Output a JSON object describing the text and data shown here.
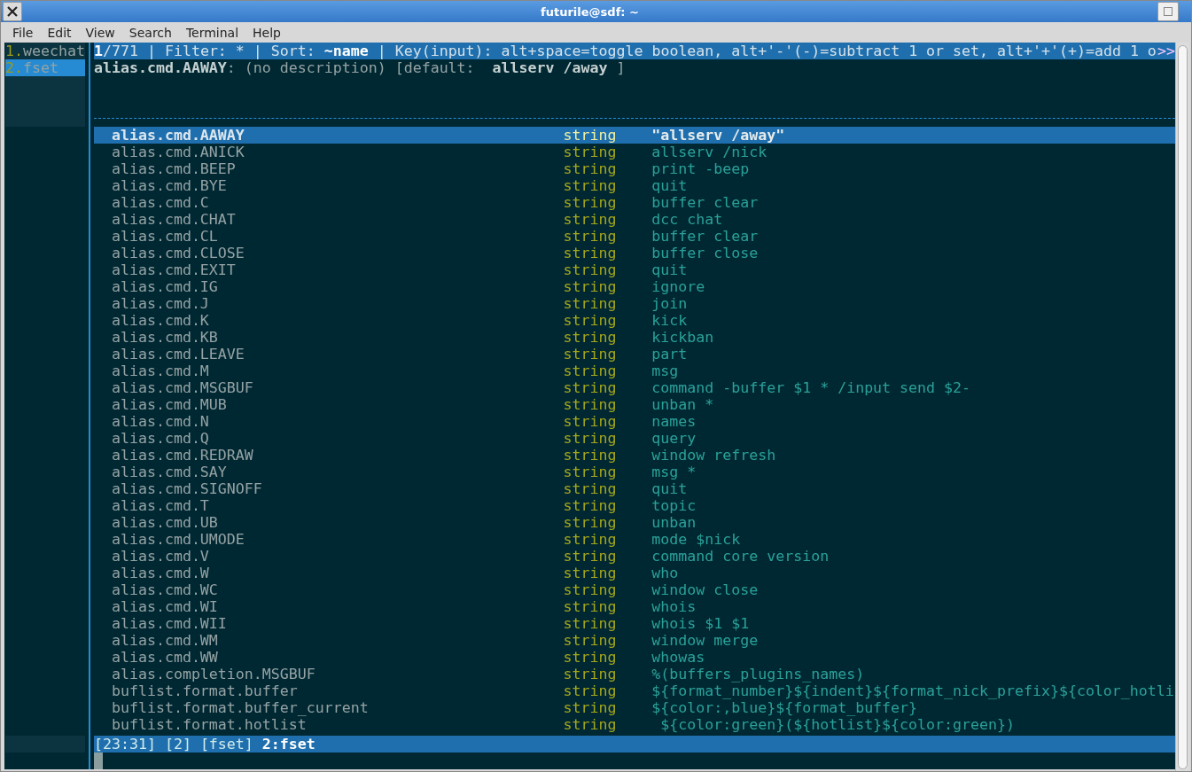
{
  "window": {
    "title": "futurile@sdf: ~"
  },
  "menu": [
    "File",
    "Edit",
    "View",
    "Search",
    "Terminal",
    "Help"
  ],
  "buflist": [
    {
      "number": "1.",
      "name": "weechat",
      "selected": false
    },
    {
      "number": "2.",
      "name": "fset",
      "selected": true
    }
  ],
  "fset": {
    "title": "**1**/771 | Filter: * | Sort: **~name** | Key(input): alt+space=toggle boolean, alt+'-'(-)=subtract 1 or set, alt+'+'(+)=add 1 o",
    "title_more": ">>",
    "description": "**alias.cmd.AAWAY**: (no description) [default:  **allserv /away** ]",
    "options": [
      {
        "name": "alias.cmd.AAWAY",
        "type": "string",
        "value": "\"allserv /away\"",
        "selected": true
      },
      {
        "name": "alias.cmd.ANICK",
        "type": "string",
        "value": "allserv /nick",
        "selected": false
      },
      {
        "name": "alias.cmd.BEEP",
        "type": "string",
        "value": "print -beep",
        "selected": false
      },
      {
        "name": "alias.cmd.BYE",
        "type": "string",
        "value": "quit",
        "selected": false
      },
      {
        "name": "alias.cmd.C",
        "type": "string",
        "value": "buffer clear",
        "selected": false
      },
      {
        "name": "alias.cmd.CHAT",
        "type": "string",
        "value": "dcc chat",
        "selected": false
      },
      {
        "name": "alias.cmd.CL",
        "type": "string",
        "value": "buffer clear",
        "selected": false
      },
      {
        "name": "alias.cmd.CLOSE",
        "type": "string",
        "value": "buffer close",
        "selected": false
      },
      {
        "name": "alias.cmd.EXIT",
        "type": "string",
        "value": "quit",
        "selected": false
      },
      {
        "name": "alias.cmd.IG",
        "type": "string",
        "value": "ignore",
        "selected": false
      },
      {
        "name": "alias.cmd.J",
        "type": "string",
        "value": "join",
        "selected": false
      },
      {
        "name": "alias.cmd.K",
        "type": "string",
        "value": "kick",
        "selected": false
      },
      {
        "name": "alias.cmd.KB",
        "type": "string",
        "value": "kickban",
        "selected": false
      },
      {
        "name": "alias.cmd.LEAVE",
        "type": "string",
        "value": "part",
        "selected": false
      },
      {
        "name": "alias.cmd.M",
        "type": "string",
        "value": "msg",
        "selected": false
      },
      {
        "name": "alias.cmd.MSGBUF",
        "type": "string",
        "value": "command -buffer $1 * /input send $2-",
        "selected": false
      },
      {
        "name": "alias.cmd.MUB",
        "type": "string",
        "value": "unban *",
        "selected": false
      },
      {
        "name": "alias.cmd.N",
        "type": "string",
        "value": "names",
        "selected": false
      },
      {
        "name": "alias.cmd.Q",
        "type": "string",
        "value": "query",
        "selected": false
      },
      {
        "name": "alias.cmd.REDRAW",
        "type": "string",
        "value": "window refresh",
        "selected": false
      },
      {
        "name": "alias.cmd.SAY",
        "type": "string",
        "value": "msg *",
        "selected": false
      },
      {
        "name": "alias.cmd.SIGNOFF",
        "type": "string",
        "value": "quit",
        "selected": false
      },
      {
        "name": "alias.cmd.T",
        "type": "string",
        "value": "topic",
        "selected": false
      },
      {
        "name": "alias.cmd.UB",
        "type": "string",
        "value": "unban",
        "selected": false
      },
      {
        "name": "alias.cmd.UMODE",
        "type": "string",
        "value": "mode $nick",
        "selected": false
      },
      {
        "name": "alias.cmd.V",
        "type": "string",
        "value": "command core version",
        "selected": false
      },
      {
        "name": "alias.cmd.W",
        "type": "string",
        "value": "who",
        "selected": false
      },
      {
        "name": "alias.cmd.WC",
        "type": "string",
        "value": "window close",
        "selected": false
      },
      {
        "name": "alias.cmd.WI",
        "type": "string",
        "value": "whois",
        "selected": false
      },
      {
        "name": "alias.cmd.WII",
        "type": "string",
        "value": "whois $1 $1",
        "selected": false
      },
      {
        "name": "alias.cmd.WM",
        "type": "string",
        "value": "window merge",
        "selected": false
      },
      {
        "name": "alias.cmd.WW",
        "type": "string",
        "value": "whowas",
        "selected": false
      },
      {
        "name": "alias.completion.MSGBUF",
        "type": "string",
        "value": "%(buffers_plugins_names)",
        "selected": false
      },
      {
        "name": "buflist.format.buffer",
        "type": "string",
        "value": "${format_number}${indent}${format_nick_prefix}${color_hotli",
        "selected": false
      },
      {
        "name": "buflist.format.buffer_current",
        "type": "string",
        "value": "${color:,blue}${format_buffer}",
        "selected": false
      },
      {
        "name": "buflist.format.hotlist",
        "type": "string",
        "value": " ${color:green}(${hotlist}${color:green})",
        "selected": false
      }
    ]
  },
  "status_bar": {
    "text": "[23:31] [2] [fset] **2:fset**"
  }
}
